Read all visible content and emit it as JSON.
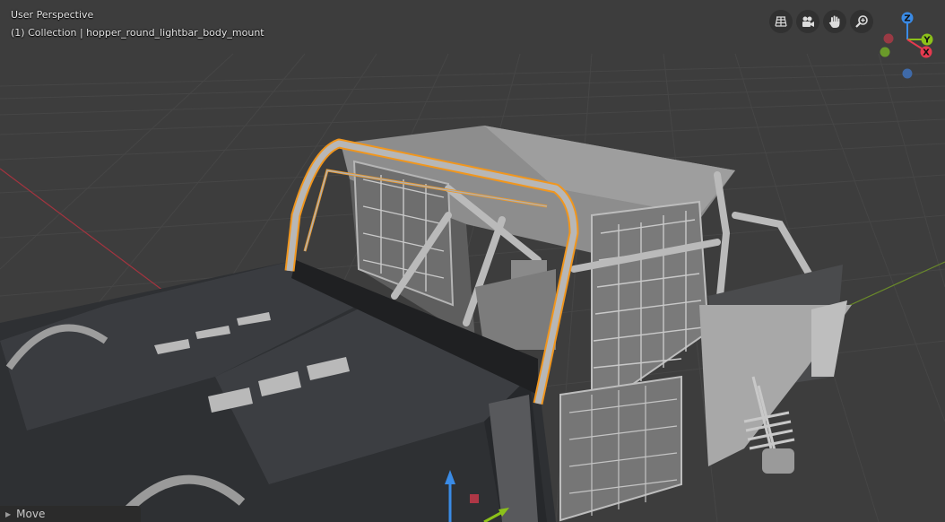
{
  "viewport": {
    "title": "User Perspective",
    "collection_info": "(1) Collection | hopper_round_lightbar_body_mount"
  },
  "nav_gizmo": {
    "buttons": [
      {
        "name": "toggle-camera-view-icon",
        "icon": "grid-icon"
      },
      {
        "name": "camera-icon",
        "icon": "camera-icon"
      },
      {
        "name": "pan-hand-icon",
        "icon": "hand-icon"
      },
      {
        "name": "zoom-icon",
        "icon": "magnifier-plus-icon"
      }
    ],
    "axes": {
      "x": "X",
      "y": "Y",
      "z": "Z"
    },
    "colors": {
      "x": "#e63a4f",
      "y": "#8cc11a",
      "z": "#3a8be6",
      "neg_x": "#9a3a44",
      "neg_y": "#6a9a2a",
      "neg_z": "#3f6aa8"
    }
  },
  "operator_panel": {
    "label": "Move"
  },
  "colors": {
    "background": "#3d3d3d",
    "grid": "#474747",
    "x_axis_line": "#a3343f",
    "y_axis_line": "#6a8a2a",
    "selection_outline": "#f0961e",
    "body_dark": "#2e3033",
    "body_light": "#9a9a9a"
  }
}
